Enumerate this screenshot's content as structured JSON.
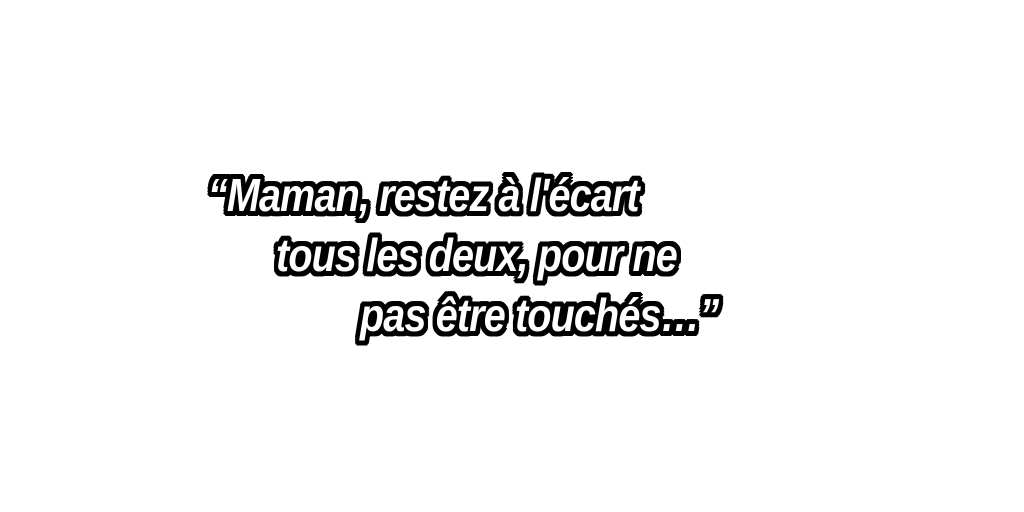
{
  "quote": {
    "lines": [
      "“Maman, restez à l'écart",
      "tous les deux, pour ne",
      "pas être touchés…”"
    ],
    "text_color": "#ffffff",
    "outline_color": "#000000"
  },
  "background_color": "#ffffff"
}
